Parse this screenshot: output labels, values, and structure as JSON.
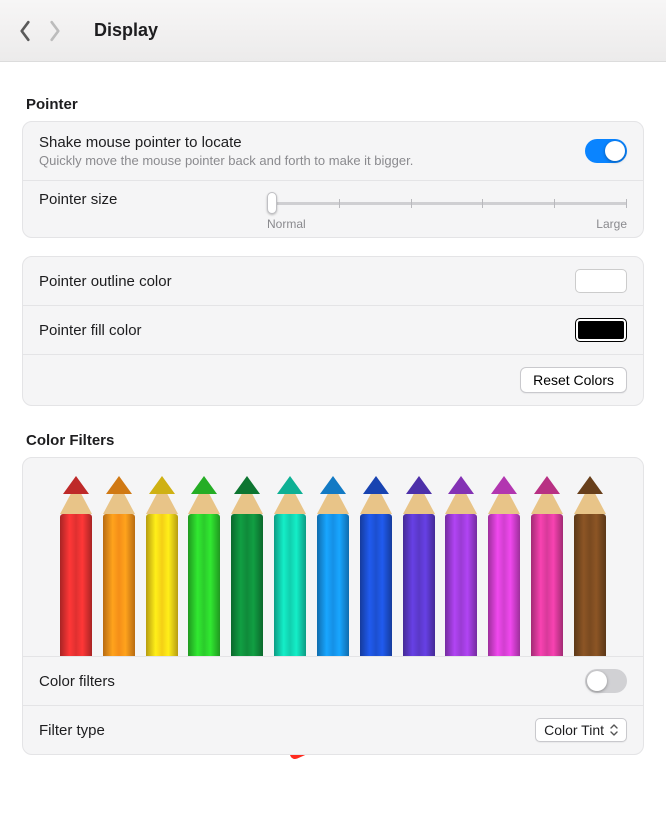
{
  "header": {
    "title": "Display"
  },
  "pointer": {
    "section_label": "Pointer",
    "shake_title": "Shake mouse pointer to locate",
    "shake_sub": "Quickly move the mouse pointer back and forth to make it bigger.",
    "shake_on": true,
    "size_label": "Pointer size",
    "size_min_label": "Normal",
    "size_max_label": "Large",
    "size_value_percent": 0,
    "outline_label": "Pointer outline color",
    "outline_color": "#FFFFFF",
    "fill_label": "Pointer fill color",
    "fill_color": "#000000",
    "reset_label": "Reset Colors",
    "overlay_cursor": {
      "fill": "#000000",
      "outline": "#FF2B1F"
    }
  },
  "color_filters": {
    "section_label": "Color Filters",
    "pencil_colors": [
      "#e03030",
      "#f58e18",
      "#f4d016",
      "#2bcb2b",
      "#0f8a3a",
      "#11cfae",
      "#1590e6",
      "#1c4fd0",
      "#5a38c7",
      "#9a3bd4",
      "#d13fcf",
      "#d8399a",
      "#7a4a20"
    ],
    "enable_label": "Color filters",
    "enable_on": false,
    "filter_type_label": "Filter type",
    "filter_type_value": "Color Tint"
  }
}
